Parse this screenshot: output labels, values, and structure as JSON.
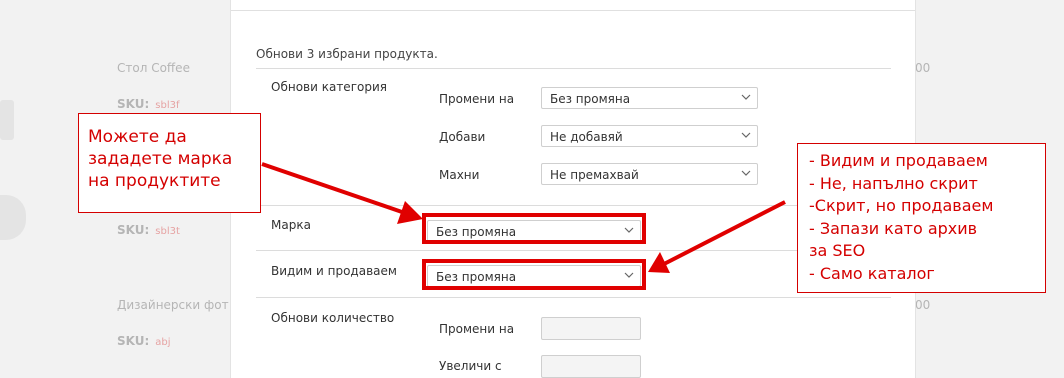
{
  "background": {
    "product1_name": "Стол Coffee",
    "product2_name": "Дизайнерски фот",
    "sku_label": "SKU:",
    "sku_values": [
      "sbl3f",
      "sbl3t",
      "abj"
    ],
    "price_fragment": "00"
  },
  "modal": {
    "intro": "Обнови 3 избрани продукта.",
    "category": {
      "label": "Обнови категория",
      "rows": [
        {
          "label": "Промени на",
          "value": "Без промяна"
        },
        {
          "label": "Добави",
          "value": "Не добавяй"
        },
        {
          "label": "Махни",
          "value": "Не премахвай"
        }
      ]
    },
    "brand": {
      "label": "Марка",
      "value": "Без промяна"
    },
    "visibility": {
      "label": "Видим и продаваем",
      "value": "Без промяна"
    },
    "quantity": {
      "label": "Обнови количество",
      "rows": [
        {
          "label": "Промени на",
          "value": ""
        },
        {
          "label": "Увеличи с",
          "value": ""
        }
      ]
    }
  },
  "annotations": {
    "left_text": "Можете да\nзададете марка\nна продуктите",
    "right_text": "- Видим и продаваем\n- Не, напълно скрит\n-Скрит, но продаваем\n- Запази като архив\nза SEO\n- Само каталог",
    "color": "#e00000"
  },
  "icons": {
    "select_caret": "chevron-down-icon"
  }
}
